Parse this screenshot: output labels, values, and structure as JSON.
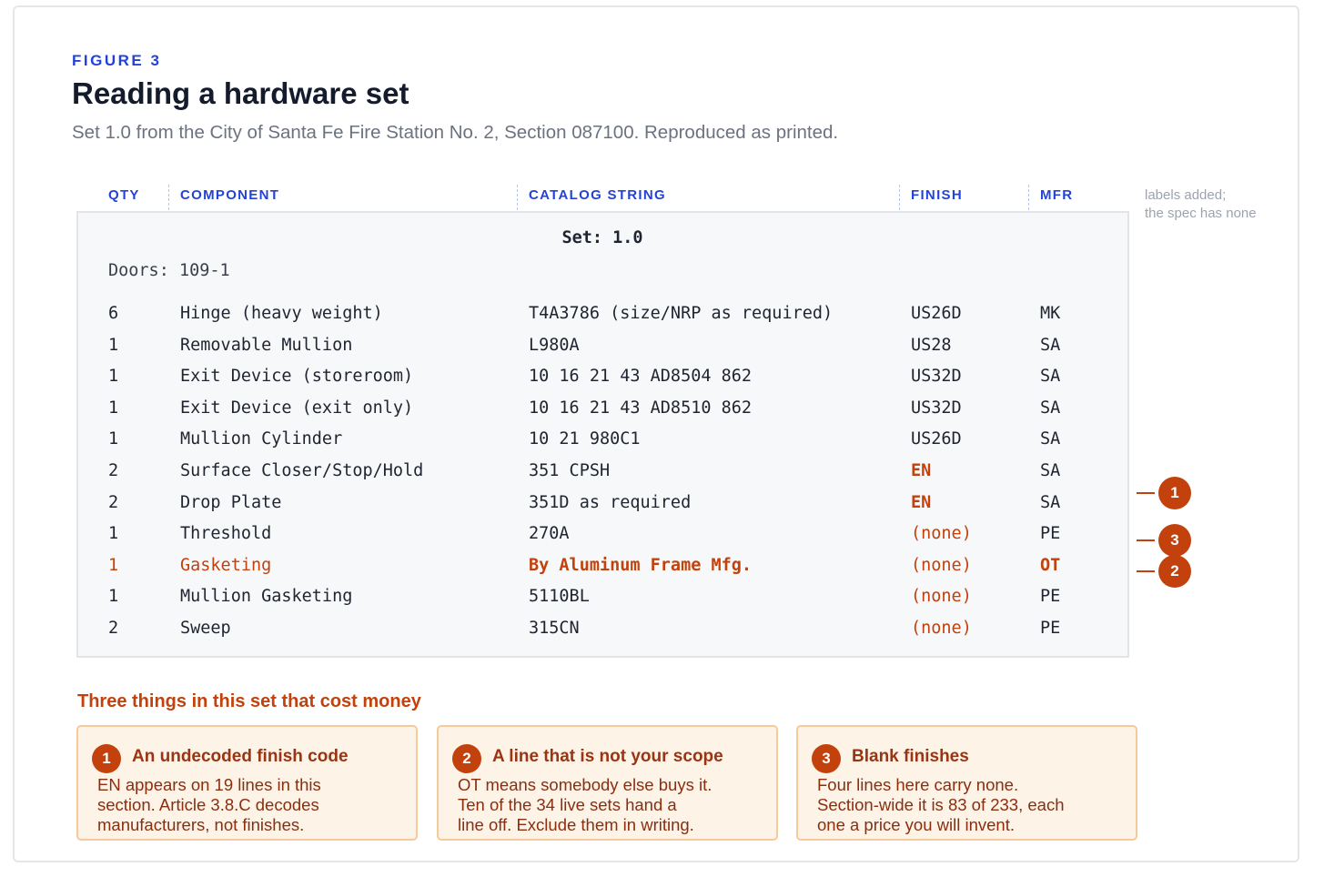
{
  "header": {
    "eyebrow": "FIGURE 3",
    "title": "Reading a hardware set",
    "subtitle": "Set 1.0 from the City of Santa Fe Fire Station No. 2, Section 087100. Reproduced as printed."
  },
  "columns": {
    "qty": "QTY",
    "component": "COMPONENT",
    "catalog": "CATALOG STRING",
    "finish": "FINISH",
    "mfr": "MFR",
    "note_line1": "labels added;",
    "note_line2": "the spec has none"
  },
  "spec": {
    "set_title": "Set: 1.0",
    "doors": "Doors: 109-1",
    "rows": [
      {
        "qty": "6",
        "component": "Hinge (heavy weight)",
        "catalog": "T4A3786 (size/NRP as required)",
        "finish": "US26D",
        "mfr": "MK"
      },
      {
        "qty": "1",
        "component": "Removable Mullion",
        "catalog": "L980A",
        "finish": "US28",
        "mfr": "SA"
      },
      {
        "qty": "1",
        "component": "Exit Device (storeroom)",
        "catalog": "10 16 21 43 AD8504 862",
        "finish": "US32D",
        "mfr": "SA"
      },
      {
        "qty": "1",
        "component": "Exit Device (exit only)",
        "catalog": "10 16 21 43 AD8510 862",
        "finish": "US32D",
        "mfr": "SA"
      },
      {
        "qty": "1",
        "component": "Mullion Cylinder",
        "catalog": "10 21 980C1",
        "finish": "US26D",
        "mfr": "SA"
      },
      {
        "qty": "2",
        "component": "Surface Closer/Stop/Hold",
        "catalog": "351 CPSH",
        "finish": "EN",
        "mfr": "SA"
      },
      {
        "qty": "2",
        "component": "Drop Plate",
        "catalog": "351D as required",
        "finish": "EN",
        "mfr": "SA"
      },
      {
        "qty": "1",
        "component": "Threshold",
        "catalog": "270A",
        "finish": "(none)",
        "mfr": "PE"
      },
      {
        "qty": "1",
        "component": "Gasketing",
        "catalog": "By Aluminum Frame Mfg.",
        "finish": "(none)",
        "mfr": "OT"
      },
      {
        "qty": "1",
        "component": "Mullion Gasketing",
        "catalog": "5110BL",
        "finish": "(none)",
        "mfr": "PE"
      },
      {
        "qty": "2",
        "component": "Sweep",
        "catalog": "315CN",
        "finish": "(none)",
        "mfr": "PE"
      }
    ]
  },
  "markers": [
    "1",
    "3",
    "2"
  ],
  "callouts": {
    "heading": "Three things in this set that cost money",
    "cards": [
      {
        "num": "1",
        "title": "An undecoded finish code",
        "line1": "EN appears on 19 lines in this",
        "line2": "section. Article 3.8.C decodes",
        "line3": "manufacturers, not finishes."
      },
      {
        "num": "2",
        "title": "A line that is not your scope",
        "line1": "OT means somebody else buys it.",
        "line2": "Ten of the 34 live sets hand a",
        "line3": "line off. Exclude them in writing."
      },
      {
        "num": "3",
        "title": "Blank finishes",
        "line1": "Four lines here carry none.",
        "line2": "Section-wide it is 83 of 233, each",
        "line3": "one a price you will invent."
      }
    ]
  },
  "colors": {
    "accent": "#2343d6",
    "alert": "#c2410c"
  }
}
